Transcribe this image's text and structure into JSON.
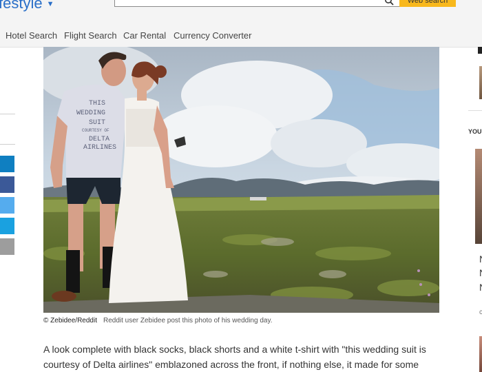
{
  "header": {
    "brand": "festyle",
    "search_button": "Web search"
  },
  "nav": {
    "items": [
      "Hotel Search",
      "Flight Search",
      "Car Rental",
      "Currency Converter"
    ]
  },
  "share_colors": [
    "#0f7fc1",
    "#3b5998",
    "#55acee",
    "#1aa1e0",
    "#9d9d9d"
  ],
  "photo": {
    "shirt_text": [
      "THIS",
      "WEDDING",
      "SUIT",
      "COURTESY OF",
      "DELTA",
      "AIRLINES"
    ]
  },
  "caption": {
    "credit": "© Zebidee/Reddit",
    "text": "Reddit user Zebidee post this photo of his wedding day."
  },
  "article": {
    "paragraph": "A look complete with black socks, black shorts and a white t-shirt with \"this wedding suit is courtesy of Delta airlines\" emblazoned across the front, if nothing else, it made for some"
  },
  "right_rail": {
    "heading": "YOU",
    "letters": [
      "N",
      "N",
      "N",
      "c"
    ]
  }
}
